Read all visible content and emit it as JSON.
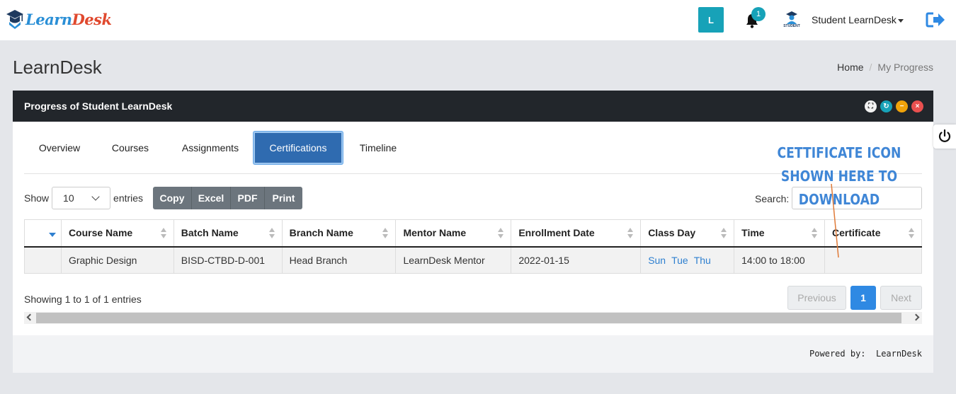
{
  "header": {
    "logo": {
      "part1": "Learn",
      "part2": "Desk"
    },
    "user_initial": "L",
    "notification_count": "1",
    "student_logo_text": "STUDENT",
    "user_name": "Student LearnDesk"
  },
  "page": {
    "title": "LearnDesk",
    "breadcrumb": {
      "home": "Home",
      "separator": "/",
      "current": "My Progress"
    }
  },
  "panel": {
    "title": "Progress of Student LearnDesk",
    "tabs": [
      {
        "label": "Overview",
        "active": false
      },
      {
        "label": "Courses",
        "active": false
      },
      {
        "label": "Assignments",
        "active": false
      },
      {
        "label": "Certifications",
        "active": true
      },
      {
        "label": "Timeline",
        "active": false
      }
    ],
    "show_label": "Show",
    "entries_value": "10",
    "entries_label": "entries",
    "export_buttons": [
      "Copy",
      "Excel",
      "PDF",
      "Print"
    ],
    "search_label": "Search:",
    "search_value": "",
    "table": {
      "columns": [
        "",
        "Course Name",
        "Batch Name",
        "Branch Name",
        "Mentor Name",
        "Enrollment Date",
        "Class Day",
        "Time",
        "Certificate"
      ],
      "rows": [
        {
          "course": "Graphic Design",
          "batch": "BISD-CTBD-D-001",
          "branch": "Head Branch",
          "mentor": "LearnDesk Mentor",
          "enrollment_date": "2022-01-15",
          "class_days": [
            "Sun",
            "Tue",
            "Thu"
          ],
          "time": "14:00 to 18:00",
          "certificate": ""
        }
      ]
    },
    "info": "Showing 1 to 1 of 1 entries",
    "pagination": {
      "previous": "Previous",
      "current": "1",
      "next": "Next"
    },
    "footer": "Powered by:  LearnDesk"
  },
  "annotation": {
    "line1": "CETTIFICATE ICON",
    "line2": "SHOWN HERE TO DOWNLOAD",
    "color": "#3f86d6"
  },
  "colors": {
    "accent": "#17a2b8",
    "active_tab": "#2f6bb0",
    "panel_header": "#22262b",
    "page_bg": "#e4e6ea"
  }
}
